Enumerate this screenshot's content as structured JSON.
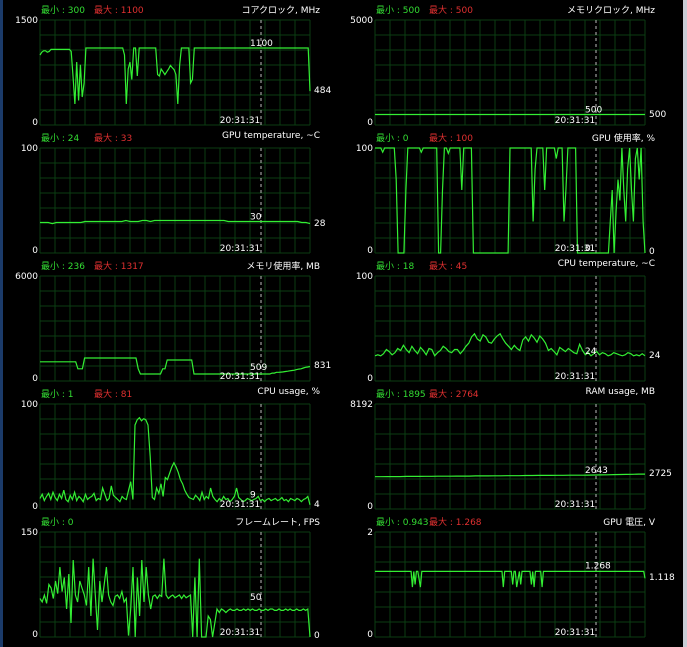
{
  "panels": [
    {
      "id": "core-clock",
      "min_label": "最小 : 300",
      "max_label": "最大 : 1100",
      "title": "コアクロック, MHz",
      "y_max": "1500",
      "y_min": "0",
      "current": "484",
      "mid_label": "1100",
      "time": "20:31:31",
      "scale_max": 1500,
      "mid_value": 1100,
      "current_value": 484,
      "series": [
        1000,
        1040,
        1060,
        1060,
        1040,
        1050,
        1080,
        1080,
        1080,
        1080,
        1080,
        1080,
        1080,
        1080,
        1080,
        1080,
        1080,
        1050,
        680,
        300,
        900,
        350,
        860,
        400,
        600,
        1100,
        1100,
        1100,
        1100,
        1100,
        1100,
        1100,
        1100,
        1100,
        1100,
        1100,
        1100,
        1100,
        1100,
        1100,
        1100,
        1100,
        1100,
        1100,
        1100,
        1100,
        1000,
        300,
        800,
        900,
        650,
        1100,
        1100,
        700,
        1100,
        1100,
        1100,
        1100,
        1100,
        1100,
        1100,
        1100,
        1100,
        1100,
        720,
        700,
        800,
        760,
        720,
        760,
        800,
        850,
        820,
        790,
        720,
        300,
        850,
        1100,
        1100,
        1100,
        1100,
        1100,
        600,
        650,
        1100,
        1100,
        1100,
        1100,
        1100,
        1100,
        1100,
        1100,
        1100,
        1100,
        1100,
        1100,
        1100,
        1100,
        1100,
        1100,
        1100,
        1100,
        1100,
        1100,
        1100,
        1100,
        1100,
        1100,
        1100,
        1100,
        1100,
        1100,
        1100,
        1100,
        1100,
        1100,
        1100,
        1100,
        1100,
        1100,
        1100,
        1100,
        1100,
        1100,
        1100,
        1100,
        1100,
        1100,
        1100,
        1100,
        1100,
        1100,
        1100,
        1100,
        1100,
        1100,
        1100,
        1100,
        1100,
        1100,
        1100,
        1100,
        1100,
        1100,
        1100,
        1100,
        1100,
        484
      ]
    },
    {
      "id": "memory-clock",
      "min_label": "最小 : 500",
      "max_label": "最大 : 500",
      "title": "メモリクロック, MHz",
      "y_max": "5000",
      "y_min": "0",
      "current": "500",
      "mid_label": "500",
      "time": "20:31:31",
      "scale_max": 5000,
      "mid_value": 500,
      "current_value": 500,
      "series": [
        500,
        500,
        500,
        500,
        500,
        500,
        500,
        500,
        500,
        500,
        500,
        500,
        500,
        500,
        500,
        500,
        500,
        500,
        500,
        500,
        500,
        500,
        500,
        500,
        500,
        500,
        500,
        500,
        500,
        500,
        500,
        500,
        500,
        500,
        500,
        500,
        500,
        500,
        500,
        500
      ]
    },
    {
      "id": "gpu-temperature",
      "min_label": "最小 : 24",
      "max_label": "最大 : 33",
      "title": "GPU temperature, ~C",
      "y_max": "100",
      "y_min": "0",
      "current": "28",
      "mid_label": "30",
      "time": "20:31:31",
      "scale_max": 100,
      "mid_value": 30,
      "current_value": 28,
      "series": [
        29,
        29,
        29,
        28,
        29,
        29,
        29,
        29,
        29,
        29,
        29,
        30,
        30,
        30,
        30,
        30,
        30,
        30,
        30,
        30,
        30,
        31,
        30,
        30,
        30,
        31,
        31,
        30,
        31,
        31,
        31,
        31,
        31,
        31,
        31,
        31,
        31,
        31,
        31,
        31,
        31,
        31,
        31,
        31,
        31,
        31,
        30,
        30,
        30,
        30,
        30,
        30,
        30,
        30,
        30,
        30,
        30,
        30,
        30,
        30,
        30,
        30,
        30,
        30,
        29,
        29,
        28
      ]
    },
    {
      "id": "gpu-usage",
      "min_label": "最小 : 0",
      "max_label": "最大 : 100",
      "title": "GPU 使用率, %",
      "y_max": "100",
      "y_min": "0",
      "current": "0",
      "mid_label": "0",
      "time": "20:31:31",
      "scale_max": 100,
      "mid_value": 0,
      "current_value": 0,
      "series": [
        100,
        100,
        100,
        100,
        96,
        100,
        100,
        100,
        100,
        100,
        100,
        70,
        0,
        0,
        0,
        0,
        60,
        100,
        100,
        100,
        100,
        100,
        100,
        100,
        96,
        100,
        100,
        100,
        100,
        100,
        100,
        100,
        100,
        0,
        0,
        60,
        100,
        100,
        95,
        100,
        100,
        100,
        100,
        100,
        100,
        60,
        100,
        100,
        100,
        100,
        100,
        0,
        0,
        0,
        0,
        0,
        0,
        0,
        0,
        0,
        0,
        0,
        0,
        0,
        0,
        0,
        0,
        0,
        0,
        0,
        100,
        100,
        100,
        100,
        100,
        100,
        100,
        100,
        100,
        100,
        100,
        100,
        30,
        80,
        100,
        100,
        100,
        100,
        60,
        100,
        100,
        100,
        100,
        100,
        90,
        100,
        100,
        100,
        30,
        60,
        100,
        100,
        100,
        100,
        100,
        0,
        0,
        0,
        0,
        0,
        0,
        0,
        0,
        0,
        0,
        0,
        0,
        0,
        0,
        0,
        0,
        0,
        30,
        60,
        0,
        40,
        70,
        50,
        100,
        60,
        30,
        80,
        100,
        60,
        30,
        90,
        100,
        70,
        100,
        30,
        0
      ]
    },
    {
      "id": "memory-usage",
      "min_label": "最小 : 236",
      "max_label": "最大 : 1317",
      "title": "メモリ使用率, MB",
      "y_max": "6000",
      "y_min": "0",
      "current": "831",
      "mid_label": "509",
      "time": "20:31:31",
      "scale_max": 6000,
      "mid_value": 509,
      "current_value": 831,
      "series": [
        1100,
        1100,
        1100,
        1100,
        1100,
        1100,
        1100,
        1100,
        1100,
        1100,
        1100,
        1100,
        1100,
        1100,
        1100,
        1100,
        1100,
        700,
        700,
        700,
        1317,
        1317,
        1317,
        1317,
        1317,
        1317,
        1317,
        1317,
        1317,
        1317,
        1317,
        1317,
        1317,
        1317,
        1317,
        1317,
        1317,
        1317,
        1317,
        1317,
        1317,
        1317,
        1317,
        1317,
        700,
        400,
        400,
        400,
        400,
        400,
        400,
        400,
        400,
        400,
        400,
        700,
        700,
        1200,
        1200,
        1200,
        1200,
        1200,
        1200,
        1200,
        1200,
        1200,
        1200,
        1200,
        1200,
        400,
        400,
        400,
        400,
        400,
        400,
        400,
        400,
        400,
        400,
        400,
        400,
        400,
        400,
        400,
        400,
        400,
        400,
        400,
        400,
        400,
        400,
        400,
        400,
        400,
        400,
        400,
        400,
        400,
        400,
        400,
        400,
        400,
        400,
        400,
        450,
        450,
        500,
        500,
        509,
        520,
        540,
        560,
        580,
        600,
        620,
        650,
        680,
        700,
        740,
        780,
        800,
        831
      ]
    },
    {
      "id": "cpu-temperature",
      "min_label": "最小 : 18",
      "max_label": "最大 : 45",
      "title": "CPU temperature, ~C",
      "y_max": "100",
      "y_min": "0",
      "current": "24",
      "mid_label": "24",
      "time": "20:31:31",
      "scale_max": 100,
      "mid_value": 24,
      "current_value": 24,
      "series": [
        24,
        25,
        24,
        26,
        30,
        28,
        25,
        27,
        31,
        29,
        34,
        30,
        27,
        33,
        29,
        26,
        32,
        29,
        25,
        31,
        30,
        24,
        27,
        29,
        33,
        31,
        28,
        27,
        30,
        30,
        26,
        29,
        33,
        36,
        42,
        45,
        40,
        38,
        44,
        42,
        37,
        36,
        40,
        43,
        45,
        40,
        36,
        33,
        30,
        34,
        31,
        29,
        39,
        42,
        38,
        44,
        41,
        37,
        43,
        40,
        36,
        29,
        31,
        28,
        25,
        32,
        30,
        28,
        31,
        29,
        27,
        26,
        35,
        29,
        25,
        27,
        24,
        26,
        28,
        25,
        27,
        26,
        24,
        25,
        27,
        26,
        25,
        24,
        25,
        27,
        26,
        24,
        25,
        24,
        26,
        24
      ]
    },
    {
      "id": "cpu-usage",
      "min_label": "最小 : 1",
      "max_label": "最大 : 81",
      "title": "CPU usage, %",
      "y_max": "100",
      "y_min": "0",
      "current": "4",
      "mid_label": "9",
      "time": "20:31:31",
      "scale_max": 100,
      "mid_value": 9,
      "current_value": 4,
      "series": [
        10,
        14,
        8,
        12,
        15,
        9,
        16,
        11,
        8,
        14,
        10,
        18,
        9,
        7,
        13,
        9,
        16,
        8,
        12,
        10,
        7,
        14,
        9,
        11,
        12,
        15,
        8,
        10,
        9,
        20,
        14,
        8,
        10,
        22,
        13,
        11,
        9,
        7,
        12,
        10,
        9,
        18,
        26,
        9,
        80,
        85,
        87,
        84,
        86,
        85,
        80,
        50,
        11,
        9,
        20,
        15,
        24,
        12,
        30,
        28,
        34,
        40,
        44,
        40,
        35,
        28,
        24,
        18,
        14,
        11,
        10,
        9,
        13,
        11,
        8,
        16,
        9,
        12,
        10,
        20,
        12,
        9,
        7,
        10,
        8,
        12,
        9,
        10,
        7,
        9,
        12,
        20,
        11,
        9,
        7,
        8,
        10,
        9,
        8,
        9,
        10,
        12,
        8,
        9,
        7,
        9,
        10,
        8,
        9,
        10,
        8,
        9,
        11,
        8,
        9,
        7,
        10,
        9,
        8,
        10,
        9,
        7,
        9,
        10,
        12,
        4
      ]
    },
    {
      "id": "ram-usage",
      "min_label": "最小 : 1895",
      "max_label": "最大 : 2764",
      "title": "RAM usage, MB",
      "y_max": "8192",
      "y_min": "0",
      "current": "2725",
      "mid_label": "2643",
      "time": "20:31:31",
      "scale_max": 8192,
      "mid_value": 2643,
      "current_value": 2725,
      "series": [
        2520,
        2520,
        2530,
        2530,
        2530,
        2540,
        2540,
        2540,
        2550,
        2550,
        2560,
        2560,
        2560,
        2570,
        2570,
        2570,
        2580,
        2580,
        2580,
        2590,
        2590,
        2600,
        2600,
        2600,
        2610,
        2610,
        2620,
        2620,
        2620,
        2630,
        2630,
        2640,
        2640,
        2640,
        2643,
        2650,
        2660,
        2670,
        2680,
        2690,
        2700,
        2710,
        2720,
        2725
      ]
    },
    {
      "id": "framerate",
      "min_label": "最小 : 0",
      "max_label": "",
      "title": "フレームレート, FPS",
      "y_max": "150",
      "y_min": "0",
      "current": "0",
      "mid_label": "50",
      "time": "20:31:31",
      "scale_max": 150,
      "mid_value": 50,
      "current_value": 0,
      "series": [
        55,
        50,
        60,
        48,
        75,
        70,
        55,
        80,
        62,
        100,
        65,
        85,
        40,
        90,
        20,
        110,
        60,
        50,
        80,
        70,
        60,
        45,
        100,
        30,
        112,
        60,
        10,
        80,
        50,
        75,
        100,
        60,
        50,
        45,
        58,
        60,
        55,
        65,
        50,
        55,
        2,
        40,
        100,
        0,
        85,
        30,
        110,
        50,
        100,
        60,
        40,
        58,
        60,
        55,
        60,
        58,
        112,
        60,
        55,
        58,
        60,
        56,
        58,
        60,
        55,
        60,
        56,
        58,
        60,
        0,
        85,
        0,
        112,
        0,
        0,
        0,
        30,
        25,
        0,
        20,
        40,
        35,
        40,
        38,
        35,
        38,
        40,
        38,
        38,
        40,
        38,
        38,
        40,
        38,
        40,
        38,
        40,
        38,
        38,
        40,
        38,
        38,
        40,
        38,
        40,
        40,
        38,
        38,
        40,
        38,
        38,
        40,
        38,
        40,
        38,
        38,
        40,
        38,
        38,
        40,
        38,
        40,
        0
      ]
    },
    {
      "id": "gpu-voltage",
      "min_label": "最小 : 0.943",
      "max_label": "最大 : 1.268",
      "title": "GPU 電圧, V",
      "y_max": "2",
      "y_min": "0",
      "current": "1.118",
      "mid_label": "1.268",
      "time": "20:31:31",
      "scale_max": 2,
      "mid_value": 1.268,
      "current_value": 1.118,
      "series": [
        1.25,
        1.25,
        1.25,
        1.25,
        1.25,
        1.25,
        1.25,
        1.25,
        1.25,
        1.25,
        1.25,
        1.25,
        1.25,
        1.25,
        1.25,
        1.25,
        1.25,
        1.25,
        1.25,
        1.25,
        1.25,
        1.25,
        1.25,
        1.25,
        1.25,
        1.25,
        1.25,
        1.25,
        0.95,
        1.25,
        1.0,
        1.25,
        1.25,
        1.1,
        0.95,
        1.25,
        1.25,
        1.25,
        1.25,
        1.25,
        1.25,
        1.25,
        1.25,
        1.25,
        1.25,
        1.25,
        1.25,
        1.25,
        1.25,
        1.25,
        1.25,
        1.25,
        1.25,
        1.25,
        1.25,
        1.25,
        1.25,
        1.25,
        1.25,
        1.25,
        1.25,
        1.25,
        1.25,
        1.25,
        1.25,
        1.25,
        1.25,
        1.25,
        1.25,
        1.25,
        1.25,
        1.25,
        1.25,
        1.25,
        1.25,
        1.25,
        1.25,
        1.25,
        1.25,
        1.25,
        1.25,
        1.25,
        1.25,
        1.25,
        1.25,
        1.25,
        1.25,
        1.25,
        1.25,
        1.25,
        1.25,
        1.25,
        1.25,
        1.25,
        1.25,
        1.25,
        0.95,
        1.25,
        1.25,
        1.25,
        1.25,
        1.25,
        1.25,
        1.0,
        1.25,
        1.25,
        0.95,
        1.1,
        1.25,
        1.0,
        1.25,
        1.25,
        1.25,
        1.25,
        1.25,
        1.25,
        1.25,
        1.0,
        1.25,
        0.95,
        1.25,
        1.25,
        1.25,
        1.25,
        1.25,
        0.95,
        1.25,
        1.25,
        1.25,
        1.25,
        1.25,
        1.25,
        1.25,
        1.25,
        1.25,
        1.25,
        1.25,
        1.25,
        1.25,
        1.25,
        1.25,
        1.25,
        1.25,
        1.25,
        1.25,
        1.25,
        1.25,
        1.25,
        1.25,
        1.25,
        1.25,
        1.25,
        1.25,
        1.25,
        1.25,
        1.25,
        1.25,
        1.25,
        1.25,
        1.25,
        1.25,
        1.25,
        1.25,
        1.25,
        1.25,
        1.25,
        1.25,
        1.25,
        1.25,
        1.25,
        1.25,
        1.25,
        1.25,
        1.25,
        1.25,
        1.25,
        1.25,
        1.25,
        1.25,
        1.25,
        1.25,
        1.25,
        1.25,
        1.25,
        1.25,
        1.25,
        1.25,
        1.25,
        1.25,
        1.25,
        1.25,
        1.25,
        1.25,
        1.25,
        1.25,
        1.25,
        1.25,
        1.25,
        1.25,
        1.25,
        1.25,
        1.25,
        1.118
      ]
    }
  ],
  "colors": {
    "background": "#000000",
    "grid": "#0b3d12",
    "trace": "#33ee33",
    "min_text": "#33dd33",
    "max_text": "#e03030",
    "marker": "#bbbbbb"
  }
}
